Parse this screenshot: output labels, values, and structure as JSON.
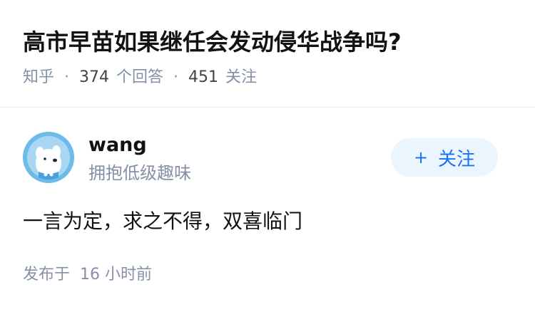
{
  "question": {
    "title": "高市早苗如果继任会发动侵华战争吗?",
    "source": "知乎",
    "separator": "·",
    "answer_count": "374",
    "answer_label": "个回答",
    "follower_count": "451",
    "follower_label": "关注"
  },
  "answer": {
    "author": {
      "name": "wang",
      "bio": "拥抱低级趣味",
      "avatar_icon": "dog-avatar-icon"
    },
    "follow_button": {
      "plus": "+",
      "label": "关注"
    },
    "content": "一言为定，求之不得，双喜临门",
    "published_prefix": "发布于",
    "published_time": "16 小时前"
  },
  "colors": {
    "text_primary": "#121212",
    "text_secondary": "#8590a6",
    "accent": "#1772f6",
    "follow_bg": "#ebf5fd",
    "avatar_bg": "#6cbbe8"
  }
}
